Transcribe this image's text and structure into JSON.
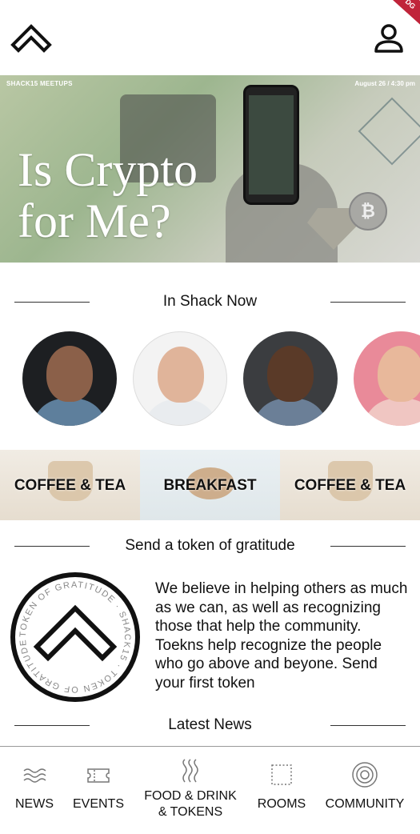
{
  "header": {
    "logo_icon": "chevron-up-logo-icon",
    "profile_icon": "user-profile-icon",
    "corner_badge": "DG"
  },
  "hero": {
    "brand": "SHACK15 MEETUPS",
    "date": "August 26 / 4:30 pm",
    "title": "Is Crypto\nfor Me?",
    "coin_symbol": "₿"
  },
  "in_shack_now": {
    "heading": "In Shack Now",
    "people": [
      {
        "name": "person-1",
        "bg": "#1d1f22",
        "skin": "#8b6049",
        "shirt": "#5e7f9c"
      },
      {
        "name": "person-2",
        "bg": "#f3f3f3",
        "skin": "#e0b49a",
        "shirt": "#e9ecef"
      },
      {
        "name": "person-3",
        "bg": "#3b3d40",
        "skin": "#5a3a28",
        "shirt": "#6b7f97"
      },
      {
        "name": "person-4",
        "bg": "#e98a99",
        "skin": "#e8b89b",
        "shirt": "#f0c6c2"
      }
    ]
  },
  "food": {
    "tiles": [
      {
        "label": "COFFEE & TEA"
      },
      {
        "label": "BREAKFAST"
      },
      {
        "label": "COFFEE & TEA"
      }
    ]
  },
  "gratitude": {
    "heading": "Send a token of gratitude",
    "body": "We believe in helping others as much as we can, as well as recognizing those that help the community. Toekns help recognize the people who go above and beyone. Send your first token",
    "seal_text": "TOKEN OF GRATITUDE · SHACK15 · TOKEN OF GRATITUDE · SHACK15 ·"
  },
  "latest_news": {
    "heading": "Latest News"
  },
  "tabbar": {
    "tabs": [
      {
        "label": "NEWS",
        "icon": "news-waves-icon"
      },
      {
        "label": "EVENTS",
        "icon": "ticket-icon"
      },
      {
        "label": "FOOD & DRINK\n& TOKENS",
        "icon": "steam-icon"
      },
      {
        "label": "ROOMS",
        "icon": "room-square-icon"
      },
      {
        "label": "COMMUNITY",
        "icon": "community-circles-icon"
      }
    ]
  },
  "colors": {
    "accent_red": "#c0243a",
    "text": "#111111"
  }
}
